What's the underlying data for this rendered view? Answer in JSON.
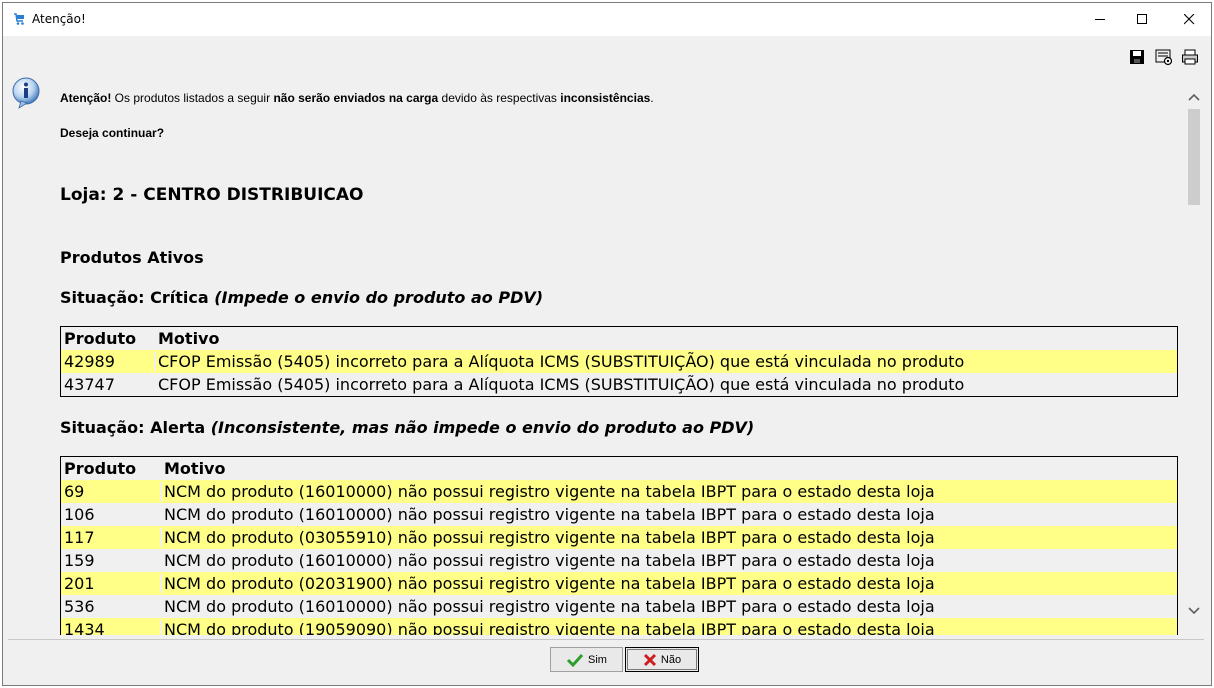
{
  "window": {
    "title": "Atenção!"
  },
  "toolbar": {
    "icons": [
      "save-icon",
      "settings-icon",
      "print-icon"
    ]
  },
  "message": {
    "intro_prefix": "Atenção!",
    "intro_part1": " Os produtos listados a seguir ",
    "intro_bold1": "não serão enviados na carga",
    "intro_part2": " devido às respectivas ",
    "intro_bold2": "inconsistências",
    "intro_end": ".",
    "confirm": "Deseja continuar?"
  },
  "store": {
    "label": "Loja: 2 - CENTRO DISTRIBUICAO"
  },
  "section": {
    "title": "Produtos Ativos"
  },
  "critical": {
    "label": "Situação: Crítica ",
    "note": "(Impede o envio do produto ao PDV)",
    "headers": {
      "product": "Produto",
      "reason": "Motivo"
    },
    "rows": [
      {
        "product": "42989",
        "reason": "CFOP Emissão (5405) incorreto para a Alíquota ICMS (SUBSTITUIÇÃO) que está vinculada no produto"
      },
      {
        "product": "43747",
        "reason": "CFOP Emissão (5405) incorreto para a Alíquota ICMS (SUBSTITUIÇÃO) que está vinculada no produto"
      }
    ]
  },
  "alert": {
    "label": "Situação: Alerta ",
    "note": "(Inconsistente, mas não impede o envio do produto ao PDV)",
    "headers": {
      "product": "Produto",
      "reason": "Motivo"
    },
    "rows": [
      {
        "product": "69",
        "reason": "NCM do produto (16010000) não possui registro vigente na tabela IBPT para o estado desta loja"
      },
      {
        "product": "106",
        "reason": "NCM do produto (16010000) não possui registro vigente na tabela IBPT para o estado desta loja"
      },
      {
        "product": "117",
        "reason": "NCM do produto (03055910) não possui registro vigente na tabela IBPT para o estado desta loja"
      },
      {
        "product": "159",
        "reason": "NCM do produto (16010000) não possui registro vigente na tabela IBPT para o estado desta loja"
      },
      {
        "product": "201",
        "reason": "NCM do produto (02031900) não possui registro vigente na tabela IBPT para o estado desta loja"
      },
      {
        "product": "536",
        "reason": "NCM do produto (16010000) não possui registro vigente na tabela IBPT para o estado desta loja"
      },
      {
        "product": "1434",
        "reason": "NCM do produto (19059090) não possui registro vigente na tabela IBPT para o estado desta loja"
      }
    ]
  },
  "buttons": {
    "yes": "Sim",
    "no": "Não"
  },
  "colors": {
    "highlight_row": "#ffff88",
    "window_bg": "#f0f0f0",
    "yes_check": "#2e9e2e",
    "no_cross": "#cc1f1f"
  }
}
